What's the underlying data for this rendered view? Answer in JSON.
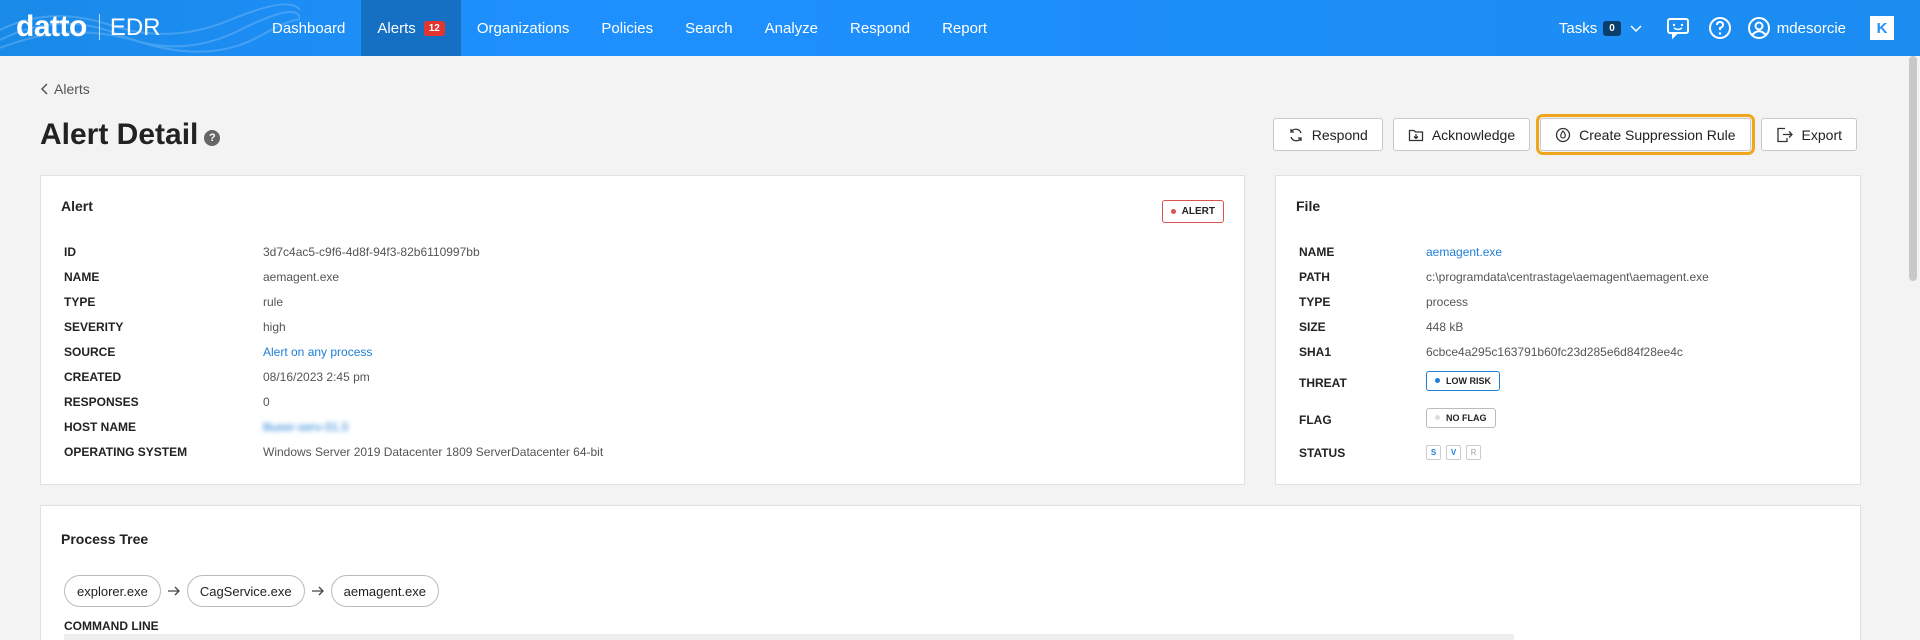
{
  "app": {
    "brand": "datto",
    "product": "EDR"
  },
  "nav": {
    "items": [
      {
        "label": "Dashboard"
      },
      {
        "label": "Alerts",
        "badge": "12",
        "active": true
      },
      {
        "label": "Organizations"
      },
      {
        "label": "Policies"
      },
      {
        "label": "Search"
      },
      {
        "label": "Analyze"
      },
      {
        "label": "Respond"
      },
      {
        "label": "Report"
      }
    ],
    "tasks_label": "Tasks",
    "tasks_count": "0",
    "username": "mdesorcie",
    "k_logo": "K"
  },
  "breadcrumb": {
    "label": "Alerts"
  },
  "page": {
    "title": "Alert Detail",
    "help": "?"
  },
  "actions": {
    "respond": "Respond",
    "acknowledge": "Acknowledge",
    "create_suppression": "Create Suppression Rule",
    "export": "Export"
  },
  "alert_card": {
    "title": "Alert",
    "badge": "ALERT",
    "rows": [
      {
        "key": "ID",
        "value": "3d7c4ac5-c9f6-4d8f-94f3-82b6110997bb"
      },
      {
        "key": "NAME",
        "value": "aemagent.exe"
      },
      {
        "key": "TYPE",
        "value": "rule"
      },
      {
        "key": "SEVERITY",
        "value": "high"
      },
      {
        "key": "SOURCE",
        "value": "Alert on any process",
        "link": true
      },
      {
        "key": "CREATED",
        "value": "08/16/2023 2:45 pm"
      },
      {
        "key": "RESPONSES",
        "value": "0"
      },
      {
        "key": "HOST NAME",
        "value": "lliuser-serv-01.0",
        "blurred": true
      },
      {
        "key": "OPERATING SYSTEM",
        "value": "Windows Server 2019 Datacenter 1809 ServerDatacenter 64-bit"
      }
    ]
  },
  "file_card": {
    "title": "File",
    "name_key": "NAME",
    "name_value": "aemagent.exe",
    "path_key": "PATH",
    "path_value": "c:\\programdata\\centrastage\\aemagent\\aemagent.exe",
    "type_key": "TYPE",
    "type_value": "process",
    "size_key": "SIZE",
    "size_value": "448 kB",
    "sha1_key": "SHA1",
    "sha1_value": "6cbce4a295c163791b60fc23d285e6d84f28ee4c",
    "threat_key": "THREAT",
    "threat_value": "LOW RISK",
    "flag_key": "FLAG",
    "flag_value": "NO FLAG",
    "status_key": "STATUS",
    "status_chips": [
      "S",
      "V",
      "R"
    ]
  },
  "process_tree": {
    "title": "Process Tree",
    "nodes": [
      "explorer.exe",
      "CagService.exe",
      "aemagent.exe"
    ],
    "command_line_label": "COMMAND LINE"
  },
  "colors": {
    "nav_bg": "#1e90ff",
    "nav_active": "#1570c4",
    "accent_link": "#1e7ed6",
    "alert_red": "#d9534f",
    "highlight": "#f0a61c"
  }
}
